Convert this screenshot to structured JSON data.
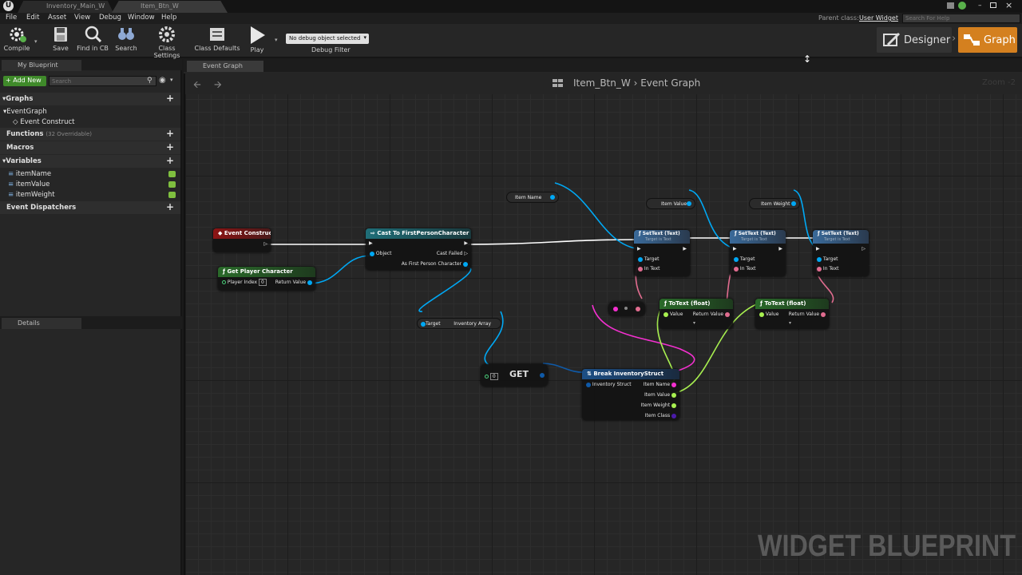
{
  "tabs": [
    "Inventory_Main_W",
    "Item_Btn_W"
  ],
  "menu": [
    "File",
    "Edit",
    "Asset",
    "View",
    "Debug",
    "Window",
    "Help"
  ],
  "parent_class_label": "Parent class:",
  "parent_class_value": "User Widget",
  "help_search_placeholder": "Search For Help",
  "toolbar": {
    "compile": "Compile",
    "save": "Save",
    "find_in_cb": "Find in CB",
    "search": "Search",
    "class_settings": "Class Settings",
    "class_defaults": "Class Defaults",
    "play": "Play",
    "debug_select": "No debug object selected",
    "debug_filter": "Debug Filter"
  },
  "mode": {
    "designer": "Designer",
    "graph": "Graph"
  },
  "my_blueprint": {
    "tab": "My Blueprint",
    "add_new": "+ Add New",
    "search_placeholder": "Search",
    "graphs": "Graphs",
    "event_graph": "EventGraph",
    "event_construct": "Event Construct",
    "functions": "Functions",
    "functions_note": "(32 Overridable)",
    "macros": "Macros",
    "variables": "Variables",
    "vars": [
      "itemName",
      "itemValue",
      "itemWeight"
    ],
    "event_dispatchers": "Event Dispatchers"
  },
  "details_tab": "Details",
  "graph_tab": "Event Graph",
  "breadcrumb": {
    "asset": "Item_Btn_W",
    "sep": "›",
    "graph": "Event Graph"
  },
  "zoom": "Zoom -2",
  "nodes": {
    "event_construct": "Event Construct",
    "get_player": "Get Player Character",
    "player_index": "Player Index",
    "player_index_val": "0",
    "return_value": "Return Value",
    "cast": "Cast To FirstPersonCharacter",
    "object": "Object",
    "cast_failed": "Cast Failed",
    "as_fpc": "As First Person Character",
    "target": "Target",
    "inventory_array": "Inventory Array",
    "get": "GET",
    "get_index": "0",
    "break_struct": "Break InventoryStruct",
    "inventory_struct": "Inventory Struct",
    "item_name": "Item Name",
    "item_value": "Item Value",
    "item_weight": "Item Weight",
    "item_class": "Item Class",
    "set_text": "SetText (Text)",
    "set_text_sub": "Target is Text",
    "in_text": "In Text",
    "to_text_float": "ToText (float)",
    "value": "Value"
  },
  "watermark": "WIDGET BLUEPRINT"
}
